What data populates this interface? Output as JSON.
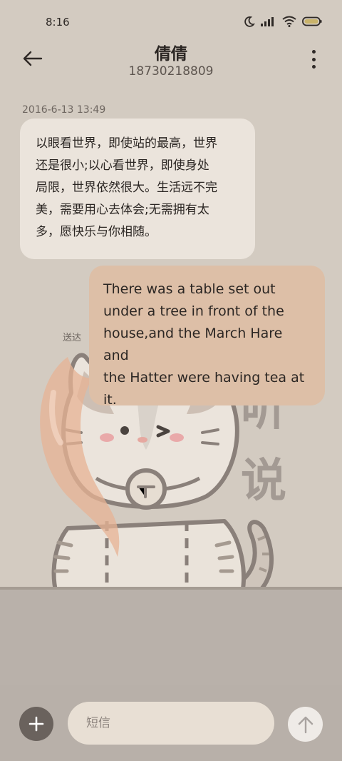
{
  "status_bar": {
    "time": "8:16",
    "icons": [
      "moon-icon",
      "signal-icon",
      "wifi-icon",
      "battery-icon"
    ]
  },
  "header": {
    "contact_name": "倩倩",
    "contact_number": "18730218809",
    "back_icon": "back-arrow-icon",
    "more_icon": "more-vertical-icon"
  },
  "messages": [
    {
      "direction": "incoming",
      "timestamp": "2016-6-13 13:49",
      "lines": [
        "以眼看世界，即使站的最高，世界",
        "还是很小;以心看世界，即使身处",
        "局限，世界依然很大。生活远不完",
        "美，需要用心去体会;无需拥有太",
        "多，愿快乐与你相随。"
      ]
    },
    {
      "direction": "outgoing",
      "status": "送达",
      "lines": [
        "There was a table set out",
        "under a tree in front of the",
        "house,and the March Hare and",
        "the Hatter were having tea at",
        "it."
      ]
    }
  ],
  "composer": {
    "placeholder": "短信",
    "value": "",
    "add_icon": "plus-icon",
    "send_icon": "send-arrow-icon"
  },
  "wallpaper": {
    "text_chars": [
      "听",
      "说"
    ]
  },
  "colors": {
    "background": "#d3cbc1",
    "incoming_bubble": "#ebe4dc",
    "outgoing_bubble": "#ddbfa7",
    "bottom_bar": "#b8b0a9"
  }
}
